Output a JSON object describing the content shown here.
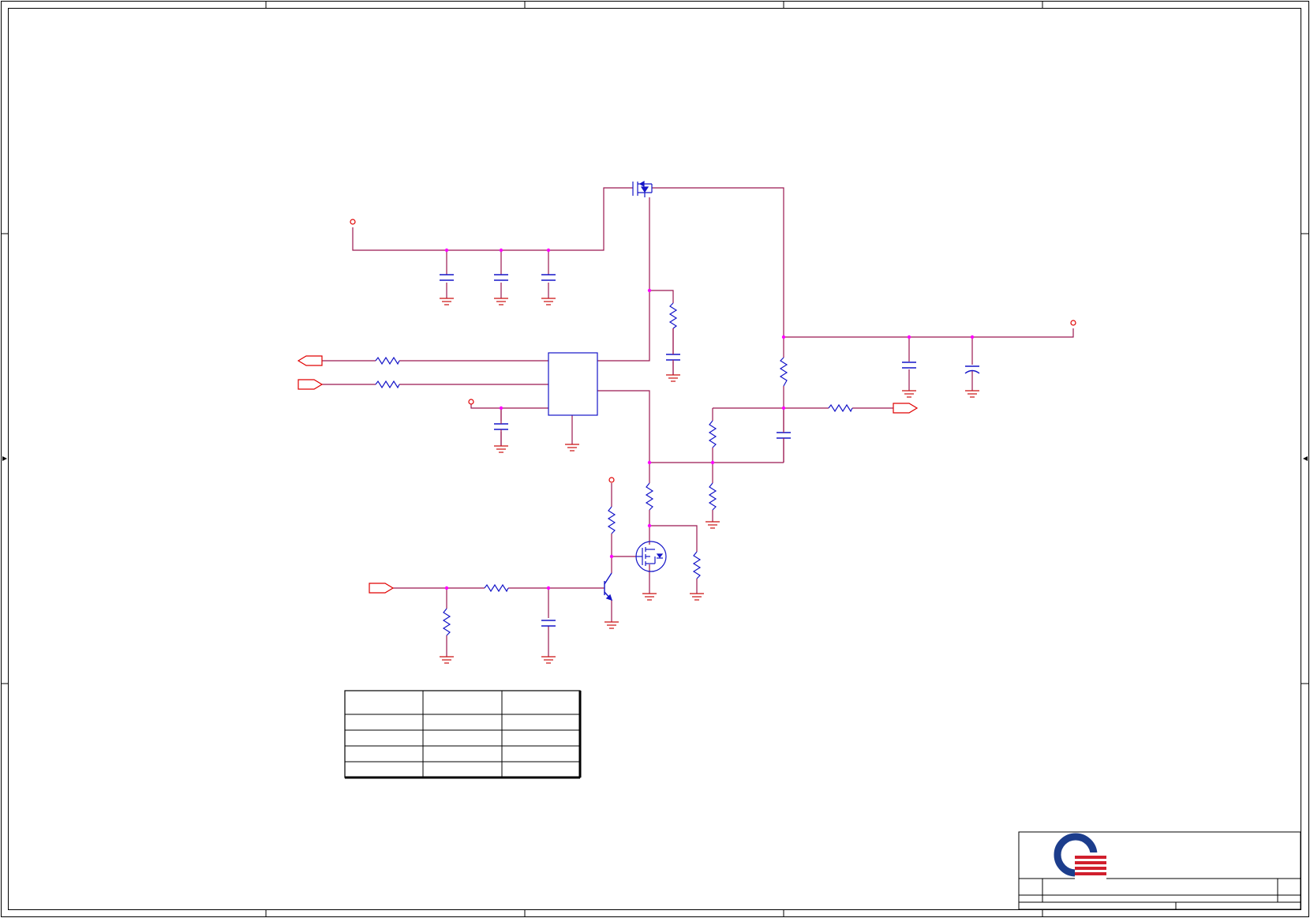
{
  "diagram": {
    "type": "electronic-schematic",
    "colors": {
      "background": "#ffffff",
      "border": "#000000",
      "wire": "#9b1850",
      "component": "#1515c8",
      "junction": "#ff00ff",
      "power_port": "#e00000",
      "ground": "#cc1010",
      "logo_blue": "#1c3d8c",
      "logo_red": "#d11f2d"
    },
    "table": {
      "rows": 5,
      "columns": 3
    },
    "title_block": {
      "logo": "quanta-logo-icon"
    }
  }
}
